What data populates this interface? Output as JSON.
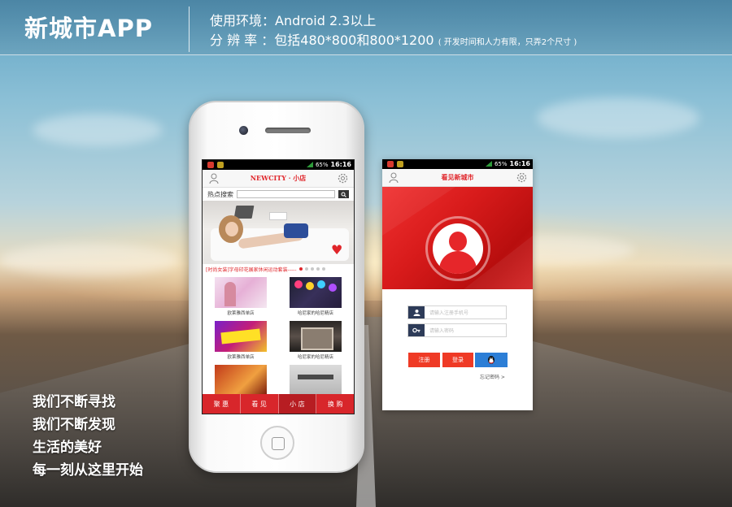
{
  "header": {
    "app_title": "新城市APP",
    "env_label": "使用环境：Android 2.3以上",
    "res_label": "分 辨 率 ：包括480*800和800*1200",
    "res_note": "( 开发时间和人力有限，只弄2个尺寸 )"
  },
  "slogans": [
    "我们不断寻找",
    "我们不断发现",
    "生活的美好",
    "每一刻从这里开始"
  ],
  "status_bar": {
    "battery": "65%",
    "time": "16:16"
  },
  "shop_screen": {
    "title": "NEWCITY · 小店",
    "search_label": "热点搜索",
    "banner_caption": "[时尚女装]字母印花展家休闲运动套装-----",
    "products": [
      {
        "label": "欧莱雅西单店"
      },
      {
        "label": "哈尼家的哈尼精店"
      },
      {
        "label": "欧莱雅西单店"
      },
      {
        "label": "哈尼家的哈尼精店"
      },
      {
        "label": ""
      },
      {
        "label": ""
      }
    ],
    "tabs": [
      {
        "label": "聚 惠"
      },
      {
        "label": "看 见"
      },
      {
        "label": "小 店"
      },
      {
        "label": "换 购"
      }
    ]
  },
  "login_screen": {
    "title": "看见新城市",
    "username_placeholder": "请输入注册手机号",
    "password_placeholder": "请输入密码",
    "register_label": "注册",
    "login_label": "登录",
    "forgot_label": "忘记密码 >"
  },
  "colors": {
    "brand_red": "#e0252a",
    "tab_red": "#d8262b",
    "qq_blue": "#2c7ed6",
    "field_icon_navy": "#2d3b58"
  }
}
